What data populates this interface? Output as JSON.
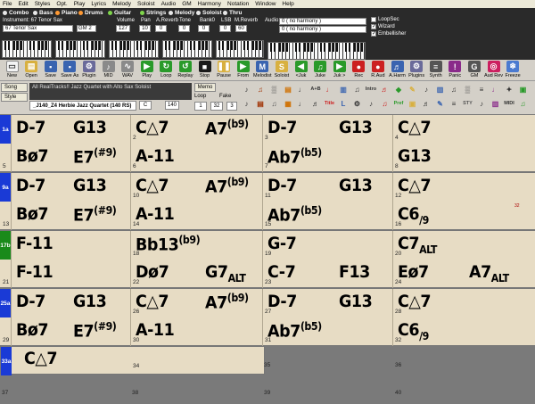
{
  "menu": [
    "File",
    "Edit",
    "Styles",
    "Opt.",
    "Play",
    "Lyrics",
    "Melody",
    "Soloist",
    "Audio",
    "GM",
    "Harmony",
    "Notation",
    "Window",
    "Help"
  ],
  "tracks": [
    {
      "name": "Combo",
      "color": "#e8e8e8"
    },
    {
      "name": "Bass",
      "color": "#e8e8e8"
    },
    {
      "name": "Piano",
      "color": "#ff9933"
    },
    {
      "name": "Drums",
      "color": "#ff9933"
    },
    {
      "name": "Guitar",
      "color": "#7fd64b"
    },
    {
      "name": "Strings",
      "color": "#7fd64b"
    },
    {
      "name": "Melody",
      "color": "#e8e8e8"
    },
    {
      "name": "Soloist",
      "color": "#e8e8e8"
    },
    {
      "name": "Thru",
      "color": "#e8e8e8"
    }
  ],
  "instrument": {
    "label": "Instrument: 67 Tenor Sax",
    "selected": "67 Tenor Sax",
    "gm": "GM 2"
  },
  "mixer": {
    "headers": [
      "Volume",
      "Pan",
      "A.Reverb",
      "Tone",
      "Bank0",
      "LSB",
      "M.Reverb"
    ],
    "values": [
      "127",
      "10",
      "0",
      "0",
      "0",
      "0",
      "60"
    ]
  },
  "audio": {
    "label": "Audio",
    "harmony1": "0 ( no harmony )",
    "harmony2": "0 ( no harmony )",
    "checks": [
      {
        "label": "LoopSec",
        "checked": false
      },
      {
        "label": "Wizard",
        "checked": true
      },
      {
        "label": "Embellisher",
        "checked": true
      }
    ]
  },
  "toolbar": [
    {
      "icon": "new-icon",
      "label": "New",
      "color": "#f4f4f4"
    },
    {
      "icon": "open-icon",
      "label": "Open",
      "color": "#d8b040"
    },
    {
      "icon": "save-icon",
      "label": "Save",
      "color": "#3a64b0"
    },
    {
      "icon": "save-as-icon",
      "label": "Save As",
      "color": "#3a64b0"
    },
    {
      "icon": "plugin-icon",
      "label": "Plugin",
      "color": "#6a6a9a"
    },
    {
      "icon": "midi-icon",
      "label": "MID",
      "color": "#8a8a8a"
    },
    {
      "icon": "wav-icon",
      "label": "WAV",
      "color": "#8a8a8a"
    },
    {
      "icon": "play-icon",
      "label": "Play",
      "color": "#2a9a2a"
    },
    {
      "icon": "loop-icon",
      "label": "Loop",
      "color": "#2a9a2a"
    },
    {
      "icon": "replay-icon",
      "label": "Replay",
      "color": "#2a9a2a"
    },
    {
      "icon": "stop-icon",
      "label": "Stop",
      "color": "#1a1a1a"
    },
    {
      "icon": "pause-icon",
      "label": "Pause",
      "color": "#d8b040"
    },
    {
      "icon": "from-icon",
      "label": "From",
      "color": "#2a9a2a"
    },
    {
      "icon": "melodist-icon",
      "label": "Melodist",
      "color": "#3a64b0"
    },
    {
      "icon": "soloist-icon",
      "label": "Soloist",
      "color": "#d8b040"
    },
    {
      "icon": "juke-prev-icon",
      "label": "<Juk",
      "color": "#2a9a2a"
    },
    {
      "icon": "juke-icon",
      "label": "Juke",
      "color": "#2a9a2a"
    },
    {
      "icon": "juke-next-icon",
      "label": "Juk >",
      "color": "#2a9a2a"
    },
    {
      "icon": "record-icon",
      "label": "Rec",
      "color": "#cc2020"
    },
    {
      "icon": "record-audio-icon",
      "label": "R.Aud",
      "color": "#cc2020"
    },
    {
      "icon": "audio-harmony-icon",
      "label": "A.Harm",
      "color": "#3a64b0"
    },
    {
      "icon": "plugins-icon",
      "label": "Plugins",
      "color": "#6a6a9a"
    },
    {
      "icon": "synth-icon",
      "label": "Synth",
      "color": "#555555"
    },
    {
      "icon": "panic-icon",
      "label": "Panic",
      "color": "#8a2a8a"
    },
    {
      "icon": "gm-icon",
      "label": "GM",
      "color": "#555555"
    },
    {
      "icon": "audio-reverb-icon",
      "label": "Aud Rev",
      "color": "#cc2060"
    },
    {
      "icon": "freeze-icon",
      "label": "Freeze",
      "color": "#4a7ad0"
    }
  ],
  "song": {
    "song_btn": "Song",
    "style_btn": "Style",
    "title": "All RealTracks!! Jazz Quartet with Alto Sax Soloist",
    "style": "_J140_Z4 Herbie Jazz Quartet (140 RS)",
    "key": "C",
    "tempo": "140",
    "memo": "Memo",
    "loop": "Loop",
    "fake": "Fake",
    "chorus_start": "1",
    "chorus_end": "32",
    "chorus_count": "3"
  },
  "parts": [
    {
      "label": "1a",
      "color": "#1a3ad6"
    },
    {
      "label": "9a",
      "color": "#1a3ad6"
    },
    {
      "label": "17b",
      "color": "#1a8a1a"
    },
    {
      "label": "25a",
      "color": "#1a3ad6"
    },
    {
      "label": "33a",
      "color": "#1a3ad6"
    }
  ],
  "bars": [
    {
      "n": "1",
      "chords": [
        "D-7"
      ]
    },
    {
      "n": "2",
      "chords": [
        "G13"
      ]
    },
    {
      "n": "",
      "chords": [
        "C△7"
      ]
    },
    {
      "n": "",
      "chords": [
        "A7(b9)"
      ]
    },
    {
      "n": "3",
      "chords": [
        "D-7"
      ]
    },
    {
      "n": "",
      "chords": [
        "G13"
      ]
    },
    {
      "n": "4",
      "chords": [
        "C△7"
      ]
    },
    {
      "n": "",
      "chords": [
        ""
      ]
    },
    {
      "n": "5",
      "chords": [
        "Bø7"
      ]
    },
    {
      "n": "",
      "chords": [
        "E7(#9)"
      ]
    },
    {
      "n": "6",
      "chords": [
        "A-11"
      ]
    },
    {
      "n": "",
      "chords": [
        ""
      ]
    },
    {
      "n": "7",
      "chords": [
        "Ab7(b5)"
      ]
    },
    {
      "n": "",
      "chords": [
        ""
      ]
    },
    {
      "n": "8",
      "chords": [
        "G13"
      ]
    },
    {
      "n": "",
      "chords": [
        ""
      ]
    }
  ],
  "grid_rows": [
    [
      "D-7",
      "G13",
      "C△7",
      "A7(b9)",
      "D-7",
      "G13",
      "C△7",
      ""
    ],
    [
      "Bø7",
      "E7(#9)",
      "A-11",
      "",
      "Ab7(b5)",
      "",
      "G13",
      ""
    ],
    [
      "D-7",
      "G13",
      "C△7",
      "A7(b9)",
      "D-7",
      "G13",
      "C△7",
      ""
    ],
    [
      "Bø7",
      "E7(#9)",
      "A-11",
      "",
      "Ab7(b5)",
      "",
      "C6/9",
      ""
    ],
    [
      "F-11",
      "",
      "Bb13(b9)",
      "",
      "G-7",
      "",
      "C7ALT",
      ""
    ],
    [
      "F-11",
      "",
      "Dø7",
      "G7ALT",
      "C-7",
      "F13",
      "Eø7",
      "A7ALT"
    ],
    [
      "D-7",
      "G13",
      "C△7",
      "A7(b9)",
      "D-7",
      "G13",
      "C△7",
      ""
    ],
    [
      "Bø7",
      "E7(#9)",
      "A-11",
      "",
      "Ab7(b5)",
      "",
      "C6/9",
      ""
    ],
    [
      "C△7",
      "",
      "",
      "",
      "",
      "",
      "",
      ""
    ]
  ],
  "bar_numbers": [
    [
      "",
      "2",
      "3",
      "4"
    ],
    [
      "5",
      "6",
      "7",
      "8"
    ],
    [
      "9",
      "10",
      "11",
      "12"
    ],
    [
      "13",
      "14",
      "15",
      "16"
    ],
    [
      "17b",
      "18",
      "19",
      "20"
    ],
    [
      "21",
      "22",
      "23",
      "24"
    ],
    [
      "25a",
      "26",
      "27",
      "28"
    ],
    [
      "29",
      "30",
      "31",
      "32"
    ],
    [
      "33a",
      "34",
      "35",
      "36"
    ],
    [
      "37",
      "38",
      "39",
      "40"
    ]
  ],
  "marker": "32"
}
